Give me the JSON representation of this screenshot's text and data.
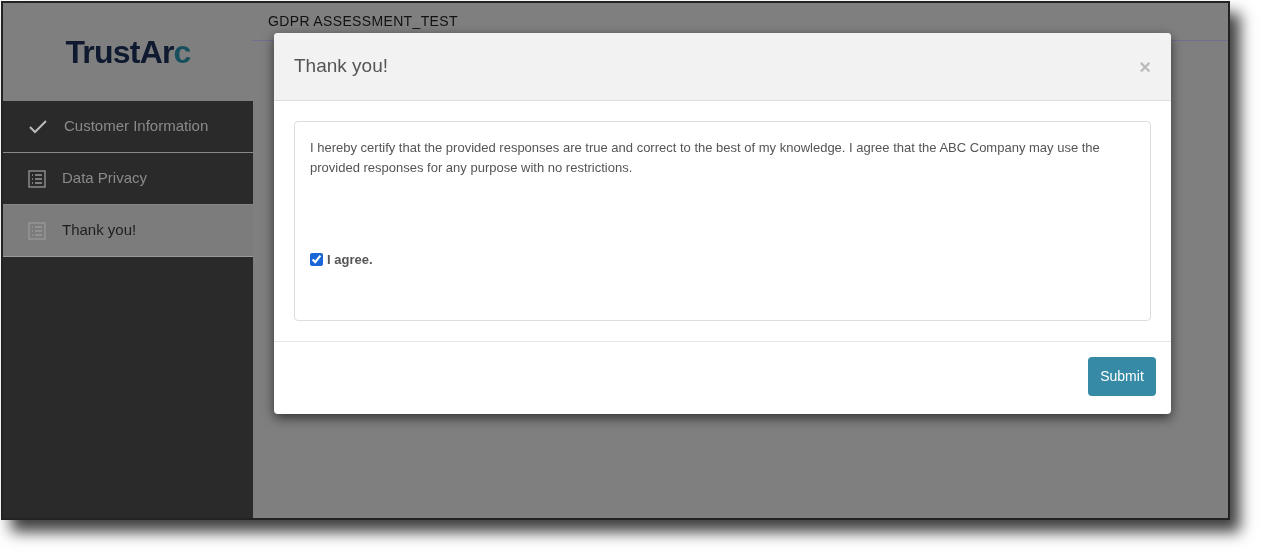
{
  "sidebar": {
    "logo": "TrustArc",
    "items": [
      {
        "label": "Customer Information",
        "kind": "done",
        "selected": false
      },
      {
        "label": "Data Privacy",
        "kind": "section",
        "selected": false
      },
      {
        "label": "Thank you!",
        "kind": "section",
        "selected": true
      }
    ]
  },
  "header": {
    "title": "GDPR ASSESSMENT_TEST"
  },
  "modal": {
    "title": "Thank you!",
    "close": "×",
    "statement": "I hereby certify that the provided responses are true and correct to the best of my knowledge. I agree that the ABC Company may use the provided responses for any purpose with no restrictions.",
    "agree": {
      "label": "I agree.",
      "checked": true
    },
    "submit": "Submit"
  }
}
